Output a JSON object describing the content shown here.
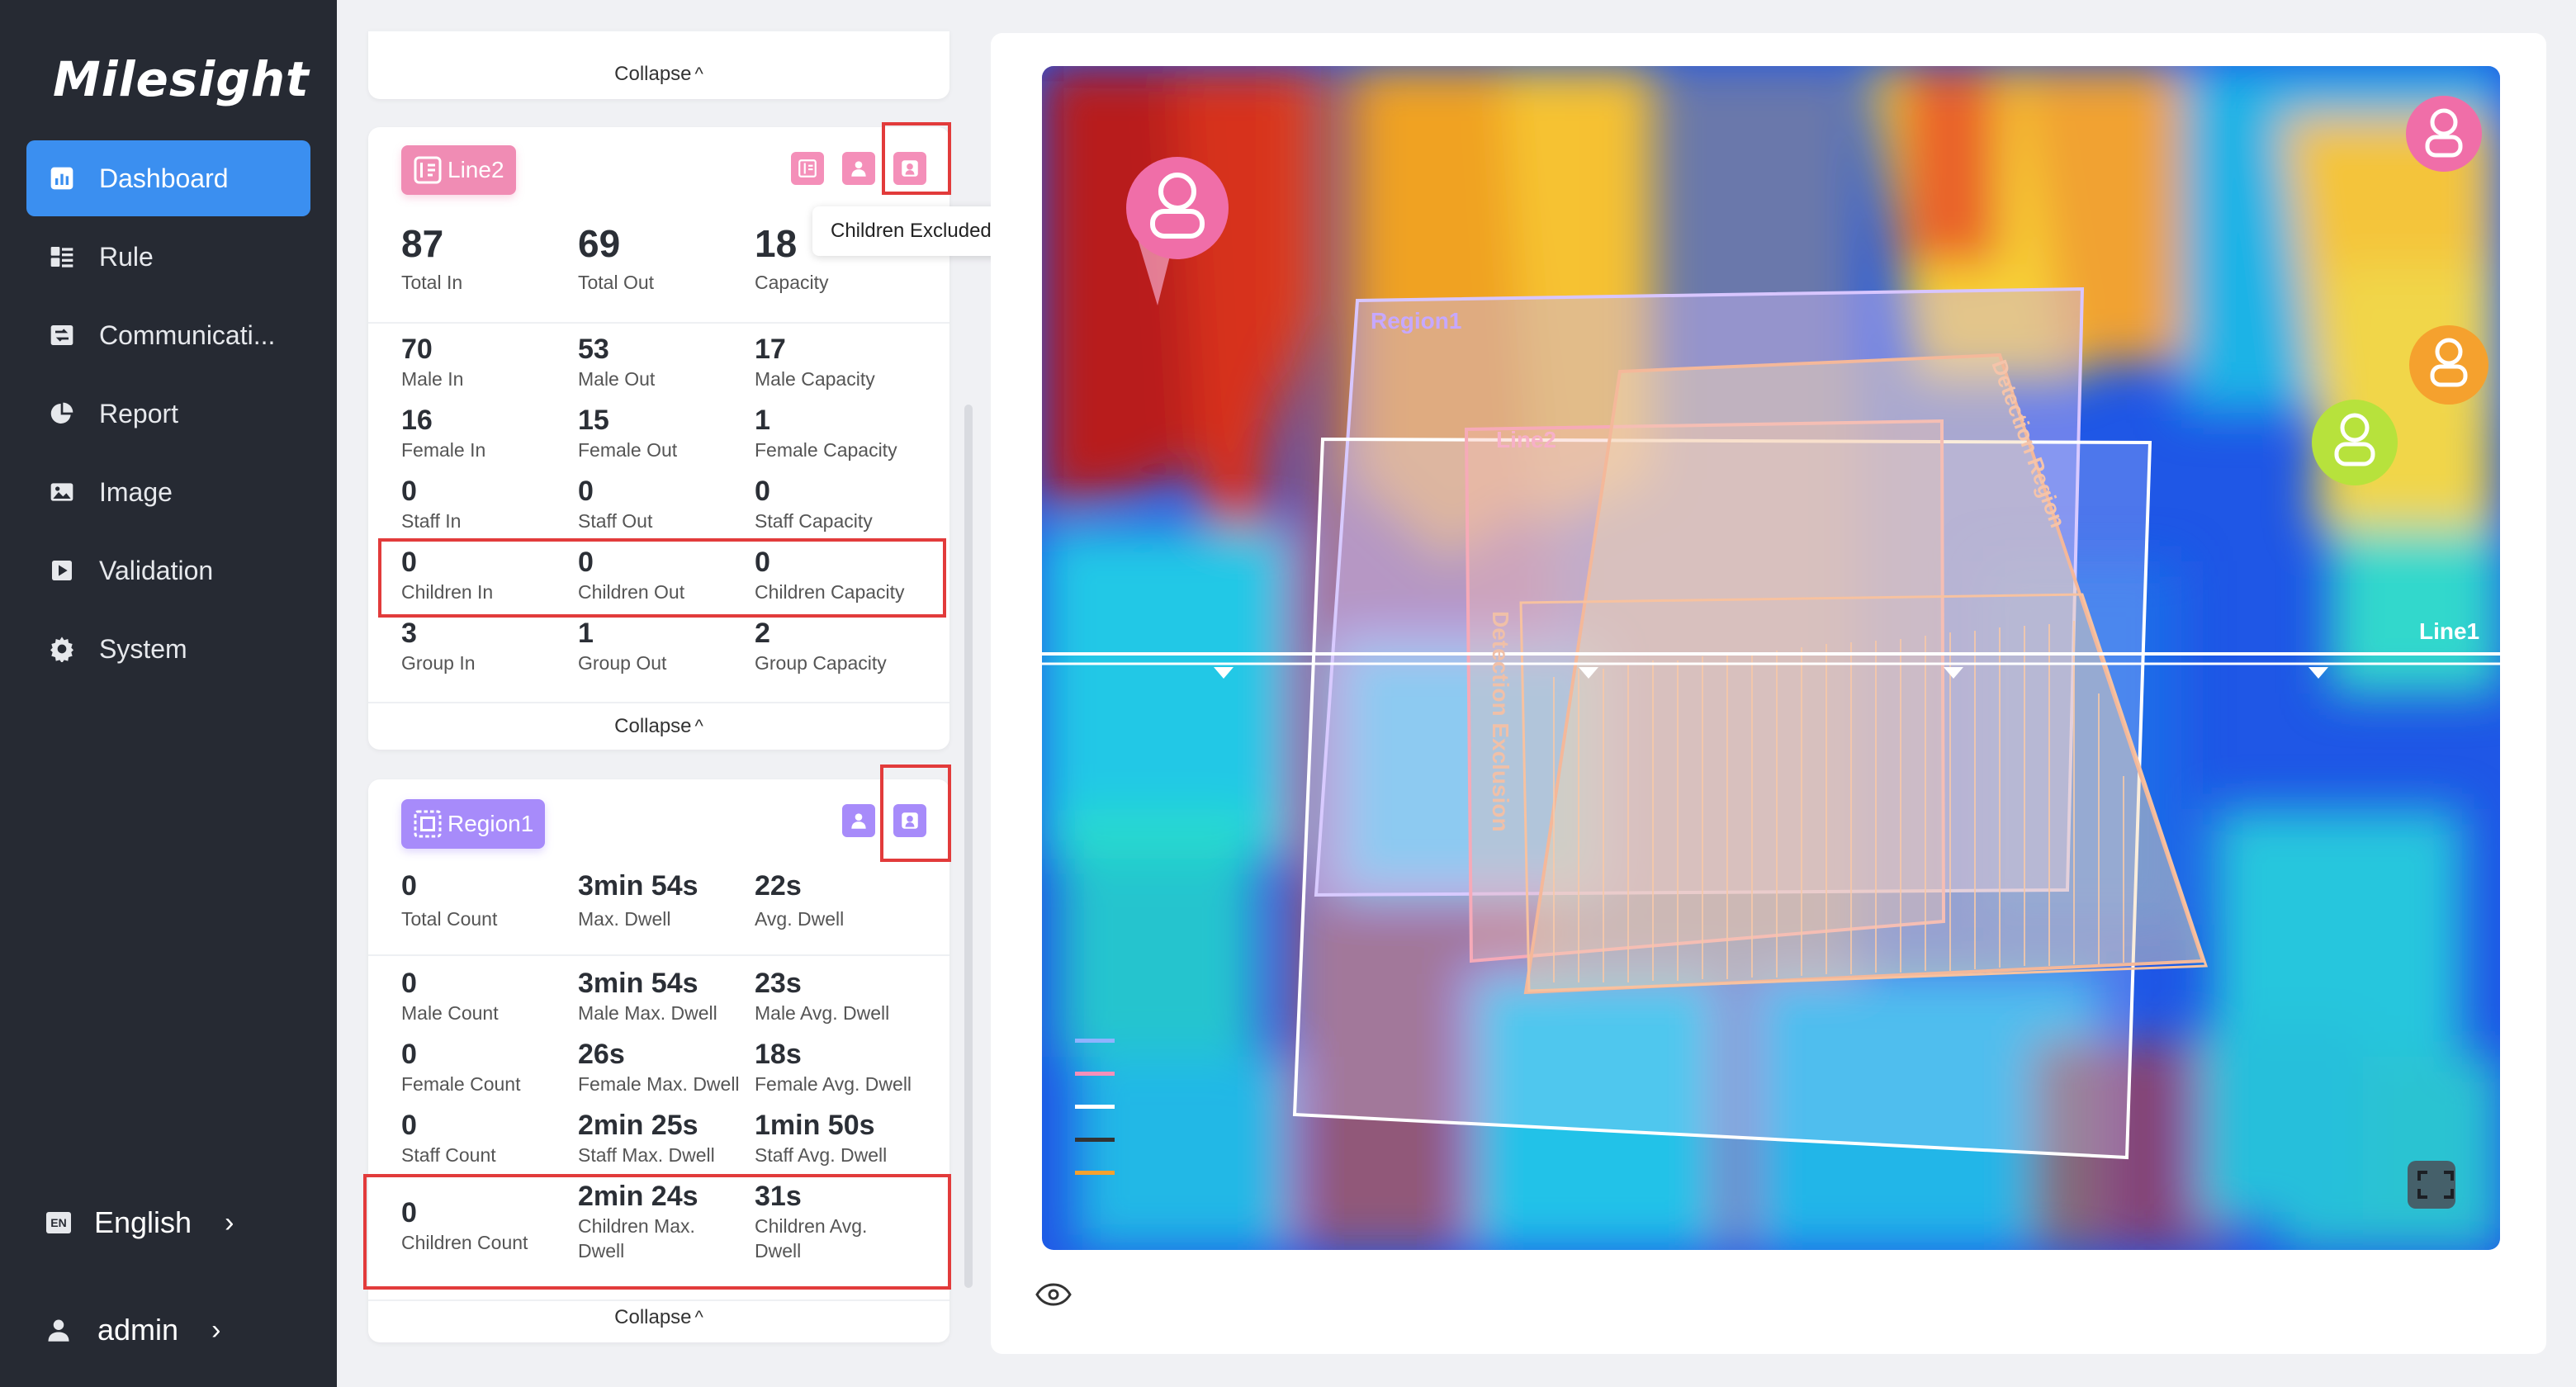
{
  "sidebar": {
    "logo": "Milesight",
    "items": [
      {
        "label": "Dashboard",
        "icon": "dashboard-icon"
      },
      {
        "label": "Rule",
        "icon": "rule-icon"
      },
      {
        "label": "Communicati...",
        "icon": "communication-icon"
      },
      {
        "label": "Report",
        "icon": "report-pie-icon"
      },
      {
        "label": "Image",
        "icon": "image-icon"
      },
      {
        "label": "Validation",
        "icon": "validation-icon"
      },
      {
        "label": "System",
        "icon": "gear-icon"
      }
    ],
    "language": "English",
    "language_code": "EN",
    "user": "admin"
  },
  "top_card": {
    "collapse": "Collapse"
  },
  "line_card": {
    "tag": "Line2",
    "tooltip": "Children Excluded",
    "totals": [
      {
        "value": "87",
        "label": "Total In"
      },
      {
        "value": "69",
        "label": "Total Out"
      },
      {
        "value": "18",
        "label": "Capacity"
      }
    ],
    "rows": [
      [
        {
          "value": "70",
          "label": "Male In"
        },
        {
          "value": "53",
          "label": "Male Out"
        },
        {
          "value": "17",
          "label": "Male Capacity"
        }
      ],
      [
        {
          "value": "16",
          "label": "Female In"
        },
        {
          "value": "15",
          "label": "Female Out"
        },
        {
          "value": "1",
          "label": "Female Capacity"
        }
      ],
      [
        {
          "value": "0",
          "label": "Staff In"
        },
        {
          "value": "0",
          "label": "Staff Out"
        },
        {
          "value": "0",
          "label": "Staff Capacity"
        }
      ],
      [
        {
          "value": "0",
          "label": "Children In"
        },
        {
          "value": "0",
          "label": "Children Out"
        },
        {
          "value": "0",
          "label": "Children Capacity"
        }
      ],
      [
        {
          "value": "3",
          "label": "Group In"
        },
        {
          "value": "1",
          "label": "Group Out"
        },
        {
          "value": "2",
          "label": "Group Capacity"
        }
      ]
    ],
    "collapse": "Collapse"
  },
  "region_card": {
    "tag": "Region1",
    "totals": [
      {
        "value": "0",
        "label": "Total Count"
      },
      {
        "value": "3min 54s",
        "label": "Max. Dwell"
      },
      {
        "value": "22s",
        "label": "Avg. Dwell"
      }
    ],
    "rows": [
      [
        {
          "value": "0",
          "label": "Male Count"
        },
        {
          "value": "3min 54s",
          "label": "Male Max. Dwell"
        },
        {
          "value": "23s",
          "label": "Male Avg. Dwell"
        }
      ],
      [
        {
          "value": "0",
          "label": "Female Count"
        },
        {
          "value": "26s",
          "label": "Female Max. Dwell"
        },
        {
          "value": "18s",
          "label": "Female Avg. Dwell"
        }
      ],
      [
        {
          "value": "0",
          "label": "Staff Count"
        },
        {
          "value": "2min 25s",
          "label": "Staff Max. Dwell"
        },
        {
          "value": "1min 50s",
          "label": "Staff Avg. Dwell"
        }
      ]
    ],
    "children": [
      {
        "value": "0",
        "label": "Children Count"
      },
      {
        "value": "2min 24s",
        "label": "Children Max. Dwell"
      },
      {
        "value": "31s",
        "label": "Children Avg. Dwell"
      }
    ],
    "collapse": "Collapse"
  },
  "view": {
    "labels": {
      "region": "Region1",
      "line2": "Line2",
      "line1": "Line1",
      "detection_exclusion": "Detection Exclusion",
      "detection_region": "Detection Region"
    },
    "colors": {
      "accent": "#3b8ff0",
      "pink": "#f08cb4",
      "purple": "#a78bfa",
      "highlight": "#e23b3b"
    }
  }
}
